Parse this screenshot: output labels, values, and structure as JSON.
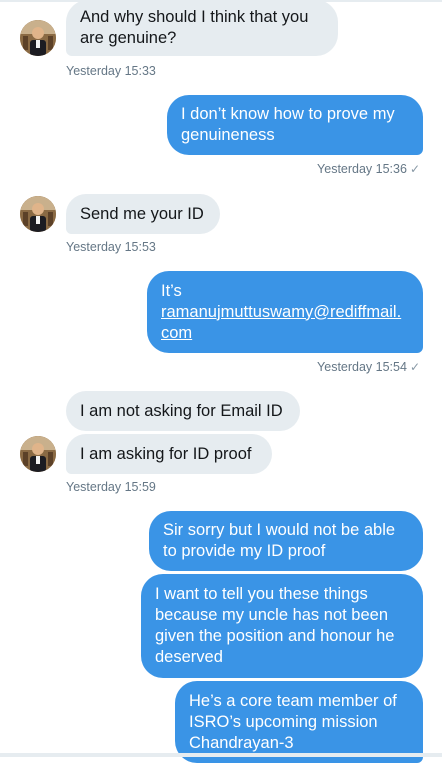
{
  "messages": [
    {
      "id": "m1",
      "direction": "incoming",
      "text": "And why should I think that you are genuine?"
    },
    {
      "id": "m2",
      "direction": "outgoing",
      "text": "I don’t know how to prove my genuineness"
    },
    {
      "id": "m3",
      "direction": "incoming",
      "text": "Send me your ID"
    },
    {
      "id": "m4",
      "direction": "outgoing",
      "text_prefix": "It’s",
      "link": "ramanujmuttuswamy@rediffmail.com",
      "link_line1": "ramanujmuttuswamy@rediffmail.",
      "link_line2": "com"
    },
    {
      "id": "m5",
      "direction": "incoming",
      "text": "I am not asking for Email ID"
    },
    {
      "id": "m6",
      "direction": "incoming",
      "text": "I am asking for ID proof"
    },
    {
      "id": "m7",
      "direction": "outgoing",
      "text": "Sir sorry but I would not be able to provide my ID proof"
    },
    {
      "id": "m8",
      "direction": "outgoing",
      "text": "I want to tell you these things because my uncle has not been given the position and honour he deserved"
    },
    {
      "id": "m9",
      "direction": "outgoing",
      "text": "He’s a core team member of ISRO’s upcoming mission Chandrayan-3"
    }
  ],
  "timestamps": {
    "t1": "Yesterday 15:33",
    "t2": "Yesterday 15:36",
    "t3": "Yesterday 15:53",
    "t4": "Yesterday 15:54",
    "t5": "Yesterday 15:59"
  },
  "read_check": "✓",
  "icons": {
    "avatar": "user-avatar-photo",
    "read_receipt": "checkmark-icon"
  },
  "colors": {
    "incoming_bubble": "#e6ecf0",
    "outgoing_bubble": "#3a94e6",
    "timestamp": "#657786"
  }
}
